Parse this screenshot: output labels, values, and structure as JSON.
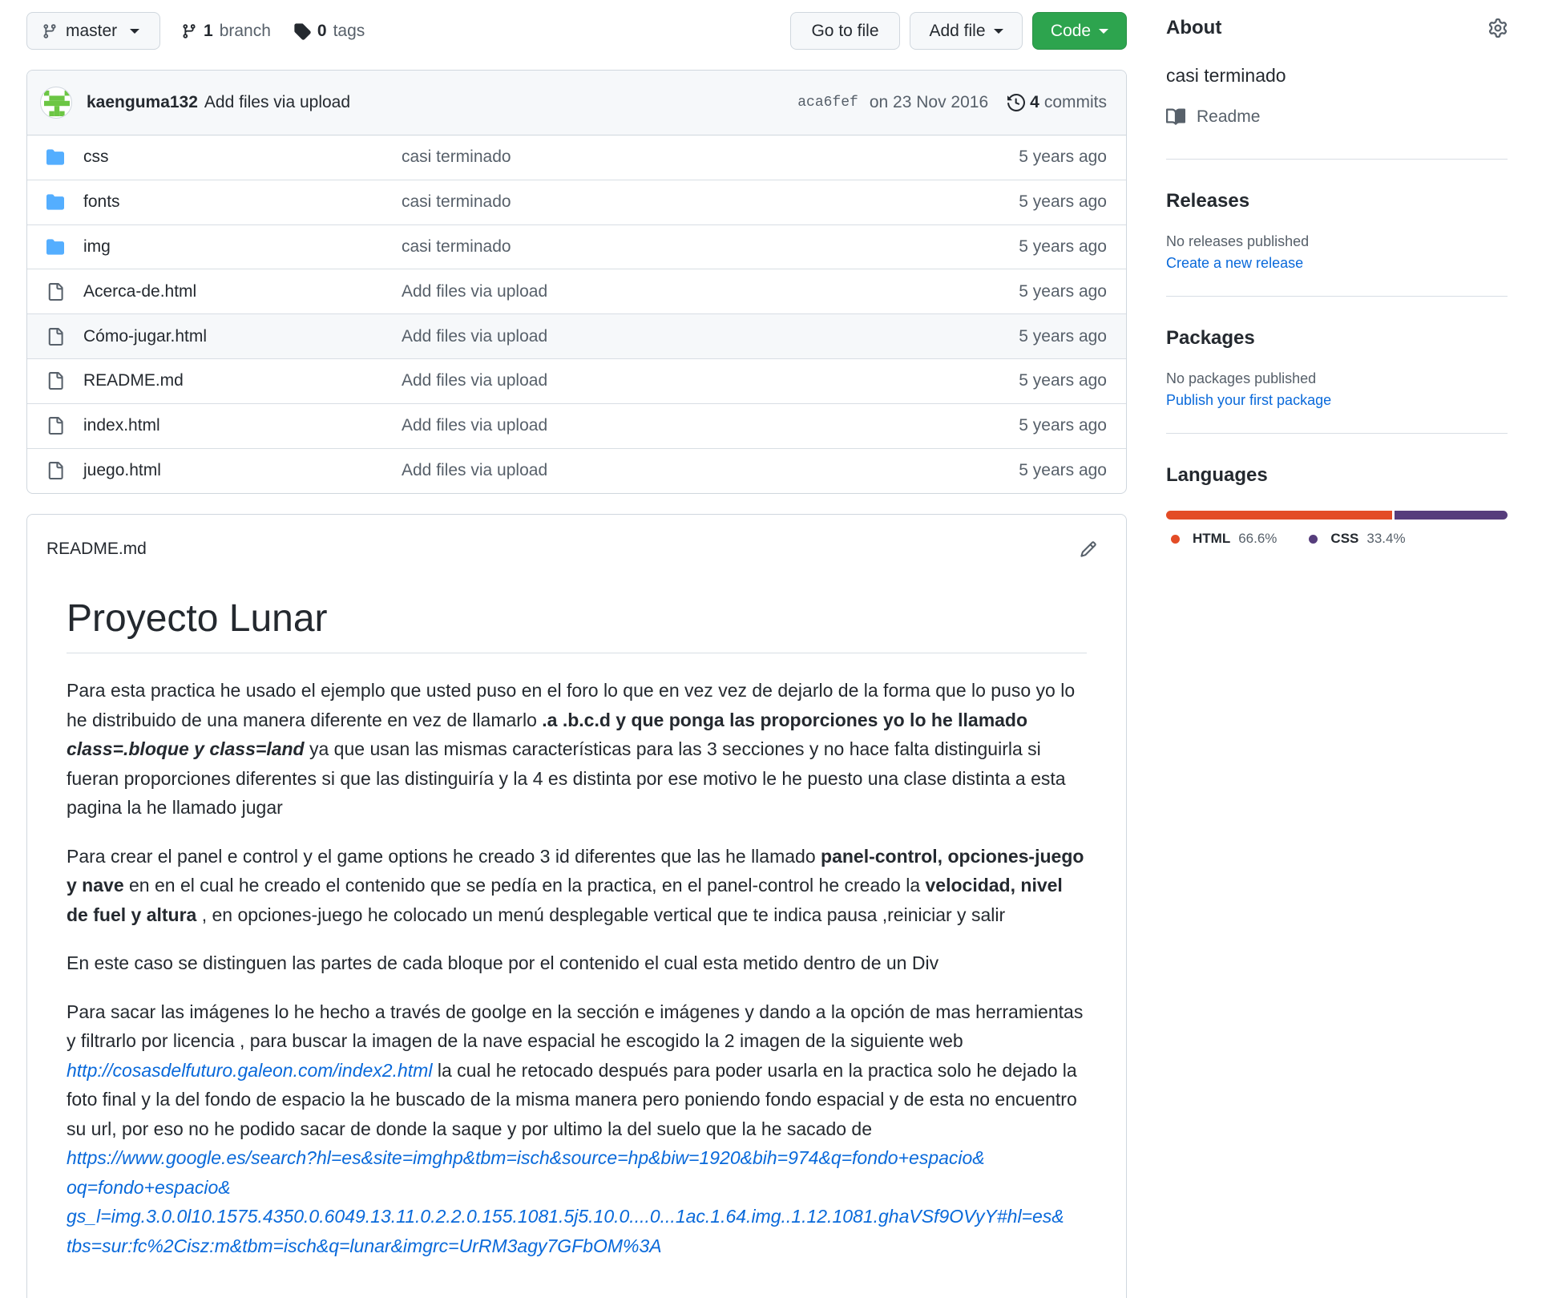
{
  "toolbar": {
    "branch_name": "master",
    "branches_count": "1",
    "branches_label": "branch",
    "tags_count": "0",
    "tags_label": "tags",
    "go_to_file": "Go to file",
    "add_file": "Add file",
    "code": "Code"
  },
  "commit": {
    "author": "kaenguma132",
    "message": "Add files via upload",
    "sha": "aca6fef",
    "date": "on 23 Nov 2016",
    "commits_count": "4",
    "commits_label": "commits"
  },
  "files": [
    {
      "name": "css",
      "type": "folder",
      "message": "casi terminado",
      "age": "5 years ago"
    },
    {
      "name": "fonts",
      "type": "folder",
      "message": "casi terminado",
      "age": "5 years ago"
    },
    {
      "name": "img",
      "type": "folder",
      "message": "casi terminado",
      "age": "5 years ago"
    },
    {
      "name": "Acerca-de.html",
      "type": "file",
      "message": "Add files via upload",
      "age": "5 years ago"
    },
    {
      "name": "Cómo-jugar.html",
      "type": "file",
      "message": "Add files via upload",
      "age": "5 years ago"
    },
    {
      "name": "README.md",
      "type": "file",
      "message": "Add files via upload",
      "age": "5 years ago"
    },
    {
      "name": "index.html",
      "type": "file",
      "message": "Add files via upload",
      "age": "5 years ago"
    },
    {
      "name": "juego.html",
      "type": "file",
      "message": "Add files via upload",
      "age": "5 years ago"
    }
  ],
  "readme": {
    "filename": "README.md",
    "title": "Proyecto Lunar",
    "p1": {
      "t1": "Para esta practica he usado el ejemplo que usted puso en el foro lo que en vez vez de dejarlo de la forma que lo puso yo lo he distribuido de una manera diferente en vez de llamarlo ",
      "b1": ".a .b.c.d y que ponga las proporciones yo lo he llamado ",
      "bi1": "class=.bloque y class=land",
      "t2": " ya que usan las mismas características para las 3 secciones y no hace falta distinguirla si fueran proporciones diferentes si que las distinguiría y la 4 es distinta por ese motivo le he puesto una clase distinta a esta pagina la he llamado jugar"
    },
    "p2": {
      "t1": "Para crear el panel e control y el game options he creado 3 id diferentes que las he llamado ",
      "b1": "panel-control, opciones-juego y nave",
      "t2": " en en el cual he creado el contenido que se pedía en la practica, en el panel-control he creado la ",
      "b2": "velocidad, nivel de fuel y altura",
      "t3": " , en opciones-juego he colocado un menú desplegable vertical que te indica pausa ,reiniciar y salir"
    },
    "p3": "En este caso se distinguen las partes de cada bloque por el contenido el cual esta metido dentro de un Div",
    "p4": {
      "t1": "Para sacar las imágenes lo he hecho a través de goolge en la sección e imágenes y dando a la opción de mas herramientas y filtrarlo por licencia , para buscar la imagen de la nave espacial he escogido la 2 imagen de la siguiente web ",
      "link1": "http://cosasdelfuturo.galeon.com/index2.html",
      "t2": " la cual he retocado después para poder usarla en la practica solo he dejado la foto final y la del fondo de espacio la he buscado de la misma manera pero poniendo fondo espacial y de esta no encuentro su url, por eso no he podido sacar de donde la saque y por ultimo la del suelo que la he sacado de ",
      "link2a": "https://www.google.es/search?hl=es&site=imghp&tbm=isch&source=hp&biw=1920&bih=974&q=fondo+espacio&",
      "link2b": "oq=fondo+espacio&",
      "link2c": "gs_l=img.3.0.0l10.1575.4350.0.6049.13.11.0.2.2.0.155.1081.5j5.10.0....0...1ac.1.64.img..1.12.1081.ghaVSf9OVyY#hl=es&",
      "link2d": "tbs=sur:fc%2Cisz:m&tbm=isch&q=lunar&imgrc=UrRM3agy7GFbOM%3A"
    }
  },
  "sidebar": {
    "about_title": "About",
    "description": "casi terminado",
    "readme_label": "Readme",
    "releases_title": "Releases",
    "releases_none": "No releases published",
    "releases_link": "Create a new release",
    "packages_title": "Packages",
    "packages_none": "No packages published",
    "packages_link": "Publish your first package",
    "languages_title": "Languages",
    "languages": [
      {
        "name": "HTML",
        "percent": "66.6%",
        "fraction": 0.666,
        "color": "#e34c26"
      },
      {
        "name": "CSS",
        "percent": "33.4%",
        "fraction": 0.334,
        "color": "#563d7c"
      }
    ]
  },
  "icons": {
    "branch": "git-branch-icon",
    "tag": "tag-icon",
    "history": "history-icon",
    "folder": "folder-icon",
    "file": "file-icon",
    "pencil": "pencil-icon",
    "book": "book-icon",
    "gear": "gear-icon"
  },
  "colors": {
    "green_button": "#2da44e",
    "folder_blue": "#54aeff",
    "link_blue": "#0969da"
  }
}
